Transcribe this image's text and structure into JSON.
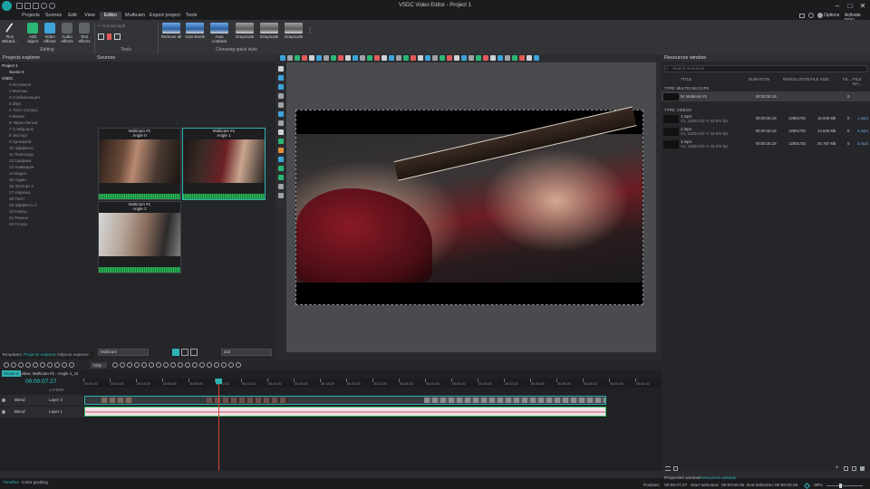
{
  "app": {
    "title": "VSDC Video Editor - Project 1"
  },
  "menu": {
    "tabs": [
      "Projects",
      "Scenes",
      "Edit",
      "View",
      "Editor",
      "Multicam",
      "Export project",
      "Tools"
    ],
    "active": "Editor",
    "options_label": "Options",
    "activate_label": "Activate PRO"
  },
  "ribbon": {
    "editing_buttons": [
      {
        "label": "Run\nWizard...",
        "icon": "wand-icon"
      },
      {
        "label": "Add\nobject",
        "icon": "add-object-icon"
      },
      {
        "label": "Video\neffects",
        "icon": "video-effects-icon"
      },
      {
        "label": "Audio\neffects",
        "icon": "audio-effects-icon"
      },
      {
        "label": "Text\neffects",
        "icon": "text-effects-icon"
      }
    ],
    "editing_group_label": "Editing",
    "tools_items": [
      "Cut and split",
      "Crop",
      "Split"
    ],
    "tools_group_label": "Tools",
    "quick_styles": [
      "Remove all",
      "Auto levels",
      "Auto contrast",
      "Grayscale",
      "Grayscale",
      "Grayscale"
    ],
    "quick_style_group_label": "Choosing quick style"
  },
  "projects_explorer": {
    "title": "Projects explorer",
    "project": "Project 1",
    "scene": "Scene 0",
    "root": "VSDC",
    "items": [
      "0 Основное",
      "1 Монтаж",
      "2 Стабилизация",
      "3 Звук",
      "4 Текст (титры)",
      "5 Маски",
      "6 Чёрно-белый",
      "7 Слайд-шоу",
      "8 Экспорт",
      "9 Хромакей",
      "10 Эффекты",
      "11 Переходы",
      "12 Графика",
      "13 Анимация",
      "14 Видео",
      "15 Аудио",
      "16 Экспорт 2",
      "17 Нарезка",
      "18 Текст",
      "19 Эффекты 2",
      "20 Клипы",
      "21 Разное",
      "22 Готово"
    ],
    "bottom_tabs": [
      "Templates",
      "Projects explorer",
      "Objects explorer"
    ]
  },
  "sources": {
    "title": "Sources",
    "clips": [
      {
        "title": "Multicam #1",
        "sub": "Angle 0"
      },
      {
        "title": "Multicam #1",
        "sub": "Angle 1"
      },
      {
        "title": "Multicam #1",
        "sub": "Angle 2"
      }
    ],
    "mode_select": "Multicam",
    "grid_select": "2x2"
  },
  "timeline": {
    "scene_tab": "Scene 0",
    "clip_tab": "Video: Multicam #1 - Angle 1_11",
    "time": "00:00:07.27",
    "zoom": "720p",
    "layers_header": "LAYERS",
    "layers": [
      {
        "blend": "Blend",
        "name": "Layer 2"
      },
      {
        "blend": "Blend",
        "name": "Layer 1"
      }
    ],
    "ruler": [
      "00:00.00",
      "00:02.00",
      "00:04.00",
      "00:06.00",
      "00:08.00",
      "00:10.00",
      "00:12.00",
      "00:14.00",
      "00:16.00",
      "00:18.00",
      "00:20.00",
      "00:22.00",
      "00:24.00",
      "00:26.00",
      "00:28.00",
      "00:30.00",
      "00:32.00",
      "00:34.00",
      "00:36.00",
      "00:38.00",
      "00:40.00",
      "00:42.00"
    ]
  },
  "resources": {
    "title": "Resources window",
    "search_placeholder": "Search resources",
    "columns": [
      "TITLE",
      "DURATION",
      "RESOLUTION",
      "FILE SIZE",
      "FIL...",
      "FILE NA..."
    ],
    "group_multicam": "TYPE: MULTICAM CLIPS",
    "multicam_rows": [
      {
        "title": "M: Multicam #1",
        "duration": "00:00:30.18",
        "resolution": "",
        "size": "",
        "fil": "0",
        "name": ""
      }
    ],
    "group_videos": "TYPE: VIDEOS",
    "video_rows": [
      {
        "title": "1.mp4",
        "sub": "V1, 1280x720 ✕ 23.976 fps",
        "duration": "00:00:30.18",
        "resolution": "1280x720",
        "size": "15.008 Mb",
        "fil": "0",
        "name": "1.mp4"
      },
      {
        "title": "2.mp4",
        "sub": "V1, 1280x720 ✕ 23.976 fps",
        "duration": "00:00:30.18",
        "resolution": "1280x720",
        "size": "14.646 Mb",
        "fil": "0",
        "name": "2.mp4"
      },
      {
        "title": "3.mp4",
        "sub": "V1, 1280x720 ✕ 23.976 fps",
        "duration": "00:00:30.18",
        "resolution": "1280x720",
        "size": "25.787 Mb",
        "fil": "0",
        "name": "3.mp4"
      }
    ],
    "bottom_tabs": [
      "Properties window",
      "Resources window"
    ]
  },
  "statusbar": {
    "left_tabs": [
      "Timeline",
      "Color grading"
    ],
    "position_label": "Position:",
    "position": "00:00:07.27",
    "start_label": "Start selection:",
    "start": "00:00:00.00",
    "end_label": "End selection:",
    "end": "00:00:00.00",
    "zoom": "39%"
  },
  "colors": {
    "accent": "#2fb3b3",
    "audio_wave": "#2dbe5b",
    "track_video": "#3a3c40",
    "track_audio": "#f3e1e6"
  }
}
